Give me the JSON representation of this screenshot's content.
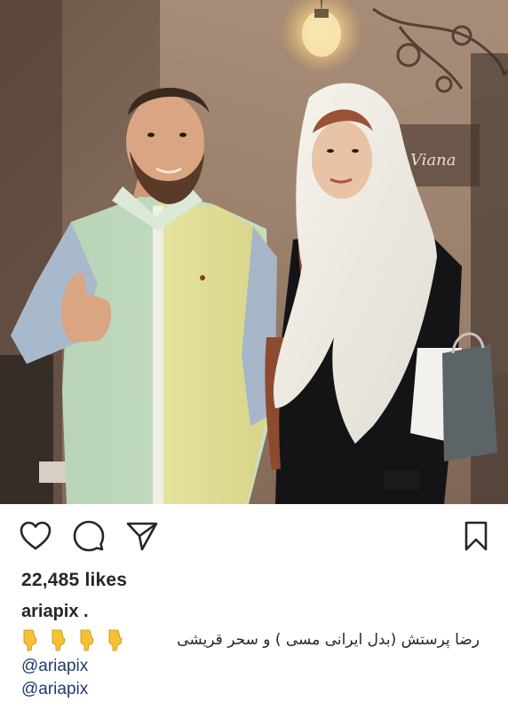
{
  "post": {
    "likes_text": "22,485 likes",
    "username": "ariapix .",
    "caption": "رضا پرستش (بدل ایرانی مسی ) و سحر قریشی",
    "emoji_count": 4,
    "tags": [
      "@ariapix",
      "@ariapix"
    ]
  },
  "photo": {
    "sign_text": "Viana"
  },
  "icons": {
    "like": "heart-icon",
    "comment": "comment-bubble-icon",
    "share": "paper-plane-icon",
    "save": "bookmark-icon",
    "emoji": "backhand-index-pointing-down-emoji"
  },
  "colors": {
    "text": "#262626",
    "link": "#1e3a6f",
    "emoji": "#f7c232"
  }
}
